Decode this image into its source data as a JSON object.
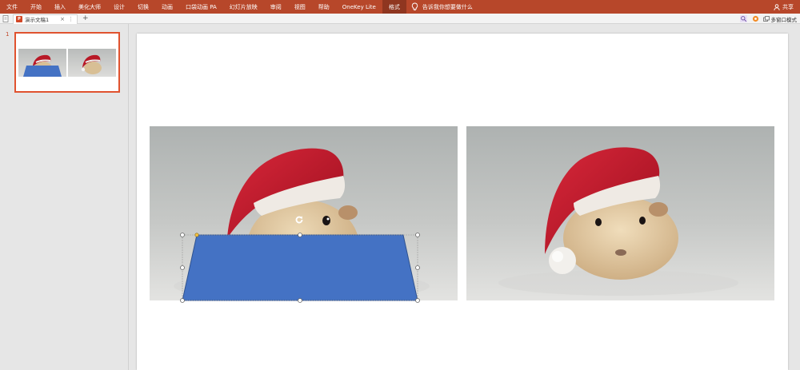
{
  "ribbon": {
    "tabs": [
      {
        "label": "文件"
      },
      {
        "label": "开始"
      },
      {
        "label": "插入"
      },
      {
        "label": "美化大师"
      },
      {
        "label": "设计"
      },
      {
        "label": "切换"
      },
      {
        "label": "动画"
      },
      {
        "label": "口袋动画 PA"
      },
      {
        "label": "幻灯片放映"
      },
      {
        "label": "审阅"
      },
      {
        "label": "视图"
      },
      {
        "label": "帮助"
      },
      {
        "label": "OneKey Lite"
      },
      {
        "label": "格式"
      }
    ],
    "active_tab": "格式",
    "tell_me": "告诉我你想要做什么",
    "share": "共享"
  },
  "tabbar": {
    "document_tab": "演示文稿1",
    "close_glyph": "×",
    "add_glyph": "+",
    "multi_window": "多窗口模式"
  },
  "thumbnails": {
    "slide_number": "1"
  },
  "icons": {
    "bulb": "lightbulb-icon",
    "share": "person-icon",
    "search": "search-icon",
    "settings": "gear-icon",
    "rotate": "rotate-handle-icon"
  },
  "colors": {
    "ribbon": "#b7472a",
    "active_tab": "#8f3620",
    "shape_fill": "#4472c4",
    "thumb_border": "#e0522f"
  }
}
